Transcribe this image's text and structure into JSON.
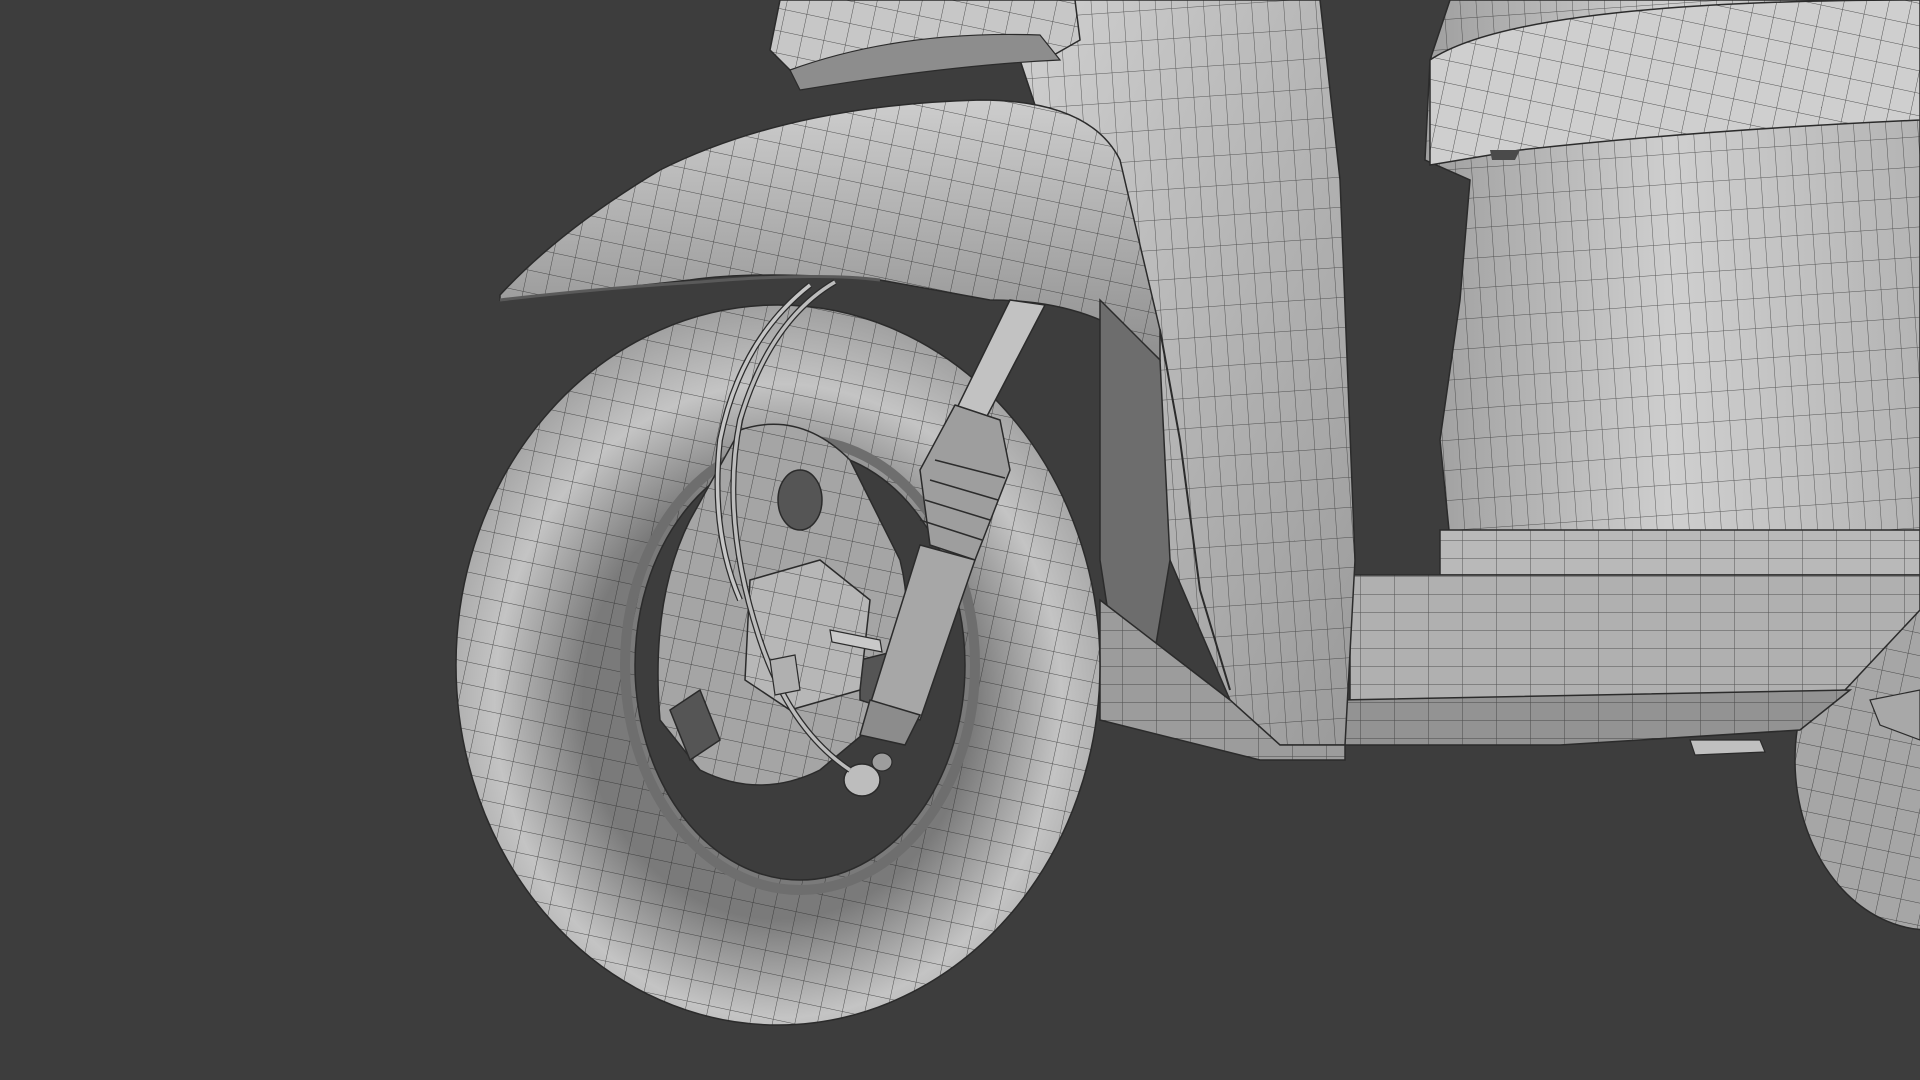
{
  "viewport": {
    "background": "#3d3d3d",
    "shading": "solid",
    "overlay": "wireframe",
    "subject": "scooter-mesh-front"
  },
  "colors": {
    "mesh_light": "#c8c8c8",
    "mesh_mid": "#a9a9a9",
    "mesh_dark": "#7e7e7e",
    "mesh_shadow": "#5d5d5d",
    "wire": "#2b2b2b"
  }
}
